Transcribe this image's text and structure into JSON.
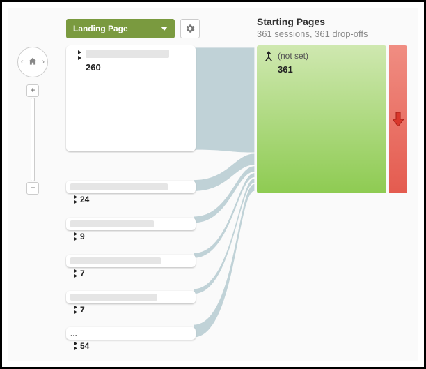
{
  "controls": {
    "dimension_label": "Landing Page"
  },
  "header": {
    "title": "Starting Pages",
    "subtitle": "361 sessions, 361 drop-offs"
  },
  "sources": [
    {
      "count": "260",
      "obscured": true
    },
    {
      "count": "24",
      "obscured": true
    },
    {
      "count": "9",
      "obscured": true
    },
    {
      "count": "7",
      "obscured": true
    },
    {
      "count": "7",
      "obscured": true
    },
    {
      "count": "54",
      "label": "..."
    }
  ],
  "destination": {
    "label": "(not set)",
    "count": "361"
  }
}
